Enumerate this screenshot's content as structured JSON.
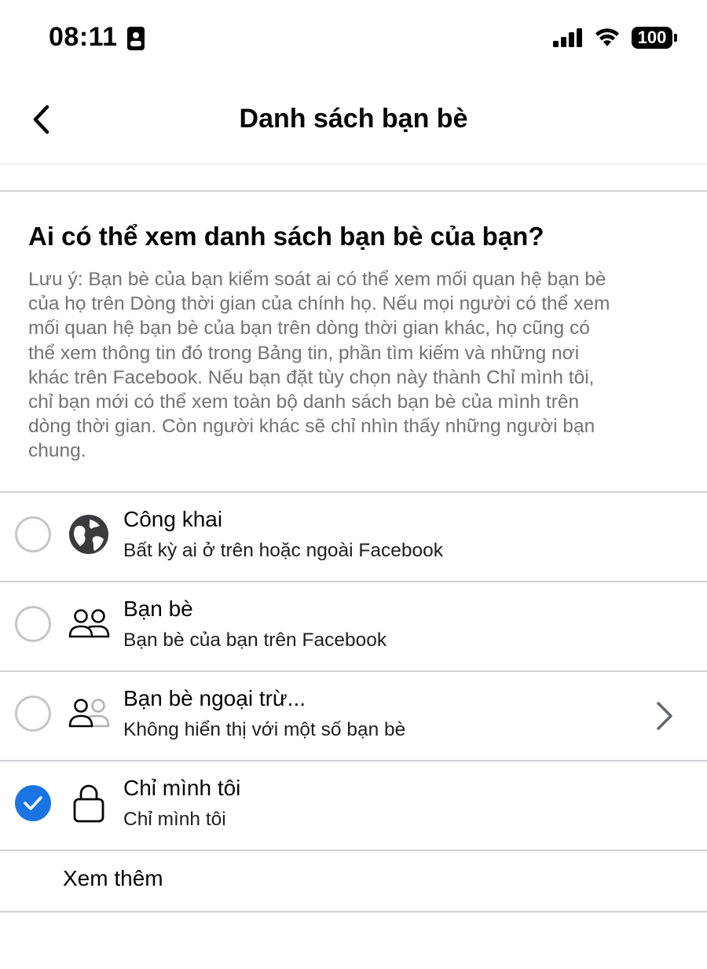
{
  "status_bar": {
    "time": "08:11",
    "battery": "100",
    "icons": [
      "id-card-icon",
      "cellular-signal-icon",
      "wifi-icon",
      "battery-icon"
    ]
  },
  "navbar": {
    "title": "Danh sách bạn bè",
    "back_icon": "chevron-left-icon"
  },
  "section": {
    "title": "Ai có thể xem danh sách bạn bè của bạn?",
    "note_lines": [
      "Lưu ý: Bạn bè của bạn kiểm soát ai có thể xem mối quan hệ bạn bè",
      "của họ trên Dòng thời gian của chính họ. Nếu mọi người có thể xem",
      "mối quan hệ bạn bè của bạn trên dòng thời gian khác, họ cũng có",
      "thể xem thông tin đó trong Bảng tin, phần tìm kiếm và những nơi",
      "khác trên Facebook. Nếu bạn đặt tùy chọn này thành Chỉ mình tôi,",
      "chỉ bạn mới có thể xem toàn bộ danh sách bạn bè của mình trên",
      "dòng thời gian. Còn người khác sẽ chỉ nhìn thấy những người bạn",
      "chung."
    ]
  },
  "options": [
    {
      "label": "Công khai",
      "desc": "Bất kỳ ai ở trên hoặc ngoài Facebook",
      "icon": "globe-icon",
      "selected": false
    },
    {
      "label": "Bạn bè",
      "desc": "Bạn bè của bạn trên Facebook",
      "icon": "friends-icon",
      "selected": false
    },
    {
      "label": "Bạn bè ngoại trừ...",
      "desc": "Không hiển thị với một số bạn bè",
      "icon": "friends-except-icon",
      "selected": false,
      "has_chevron": true
    },
    {
      "label": "Chỉ mình tôi",
      "desc": "Chỉ mình tôi",
      "icon": "lock-icon",
      "selected": true
    }
  ],
  "see_more": "Xem thêm",
  "colors": {
    "accent": "#1b74e4",
    "muted_text": "#737373",
    "divider": "#cfd1d4"
  }
}
